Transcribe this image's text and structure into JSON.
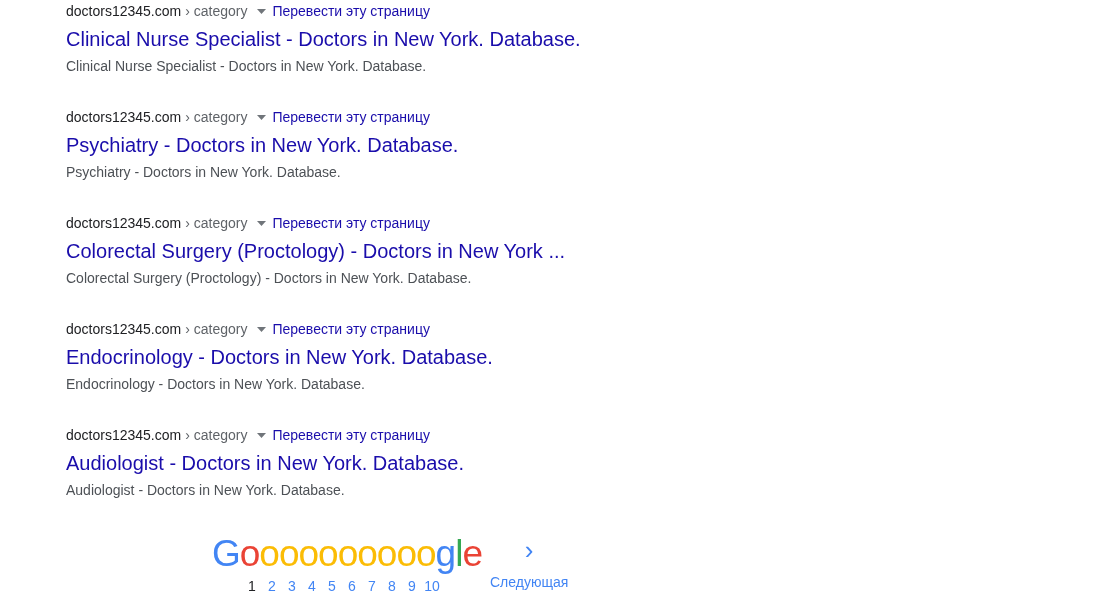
{
  "results": [
    {
      "site": "doctors12345.com",
      "path": "› category",
      "translate": "Перевести эту страницу",
      "title": "Clinical Nurse Specialist - Doctors in New York. Database.",
      "snippet": "Clinical Nurse Specialist - Doctors in New York. Database."
    },
    {
      "site": "doctors12345.com",
      "path": "› category",
      "translate": "Перевести эту страницу",
      "title": "Psychiatry - Doctors in New York. Database.",
      "snippet": "Psychiatry - Doctors in New York. Database."
    },
    {
      "site": "doctors12345.com",
      "path": "› category",
      "translate": "Перевести эту страницу",
      "title": "Colorectal Surgery (Proctology) - Doctors in New York ...",
      "snippet": "Colorectal Surgery (Proctology) - Doctors in New York. Database."
    },
    {
      "site": "doctors12345.com",
      "path": "› category",
      "translate": "Перевести эту страницу",
      "title": "Endocrinology - Doctors in New York. Database.",
      "snippet": "Endocrinology - Doctors in New York. Database."
    },
    {
      "site": "doctors12345.com",
      "path": "› category",
      "translate": "Перевести эту страницу",
      "title": "Audiologist - Doctors in New York. Database.",
      "snippet": "Audiologist - Doctors in New York. Database."
    }
  ],
  "pagination": {
    "logo": [
      {
        "char": "G",
        "color": "#4285f4"
      },
      {
        "char": "o",
        "color": "#ea4335"
      },
      {
        "char": "ooooooooo",
        "color": "#fbbc05"
      },
      {
        "char": "g",
        "color": "#4285f4"
      },
      {
        "char": "l",
        "color": "#34a853"
      },
      {
        "char": "e",
        "color": "#ea4335"
      }
    ],
    "pages": [
      {
        "label": "1",
        "selected": true
      },
      {
        "label": "2",
        "selected": false
      },
      {
        "label": "3",
        "selected": false
      },
      {
        "label": "4",
        "selected": false
      },
      {
        "label": "5",
        "selected": false
      },
      {
        "label": "6",
        "selected": false
      },
      {
        "label": "7",
        "selected": false
      },
      {
        "label": "8",
        "selected": false
      },
      {
        "label": "9",
        "selected": false
      },
      {
        "label": "10",
        "selected": false
      }
    ],
    "next": {
      "arrow": "›",
      "label": "Следующая"
    }
  }
}
